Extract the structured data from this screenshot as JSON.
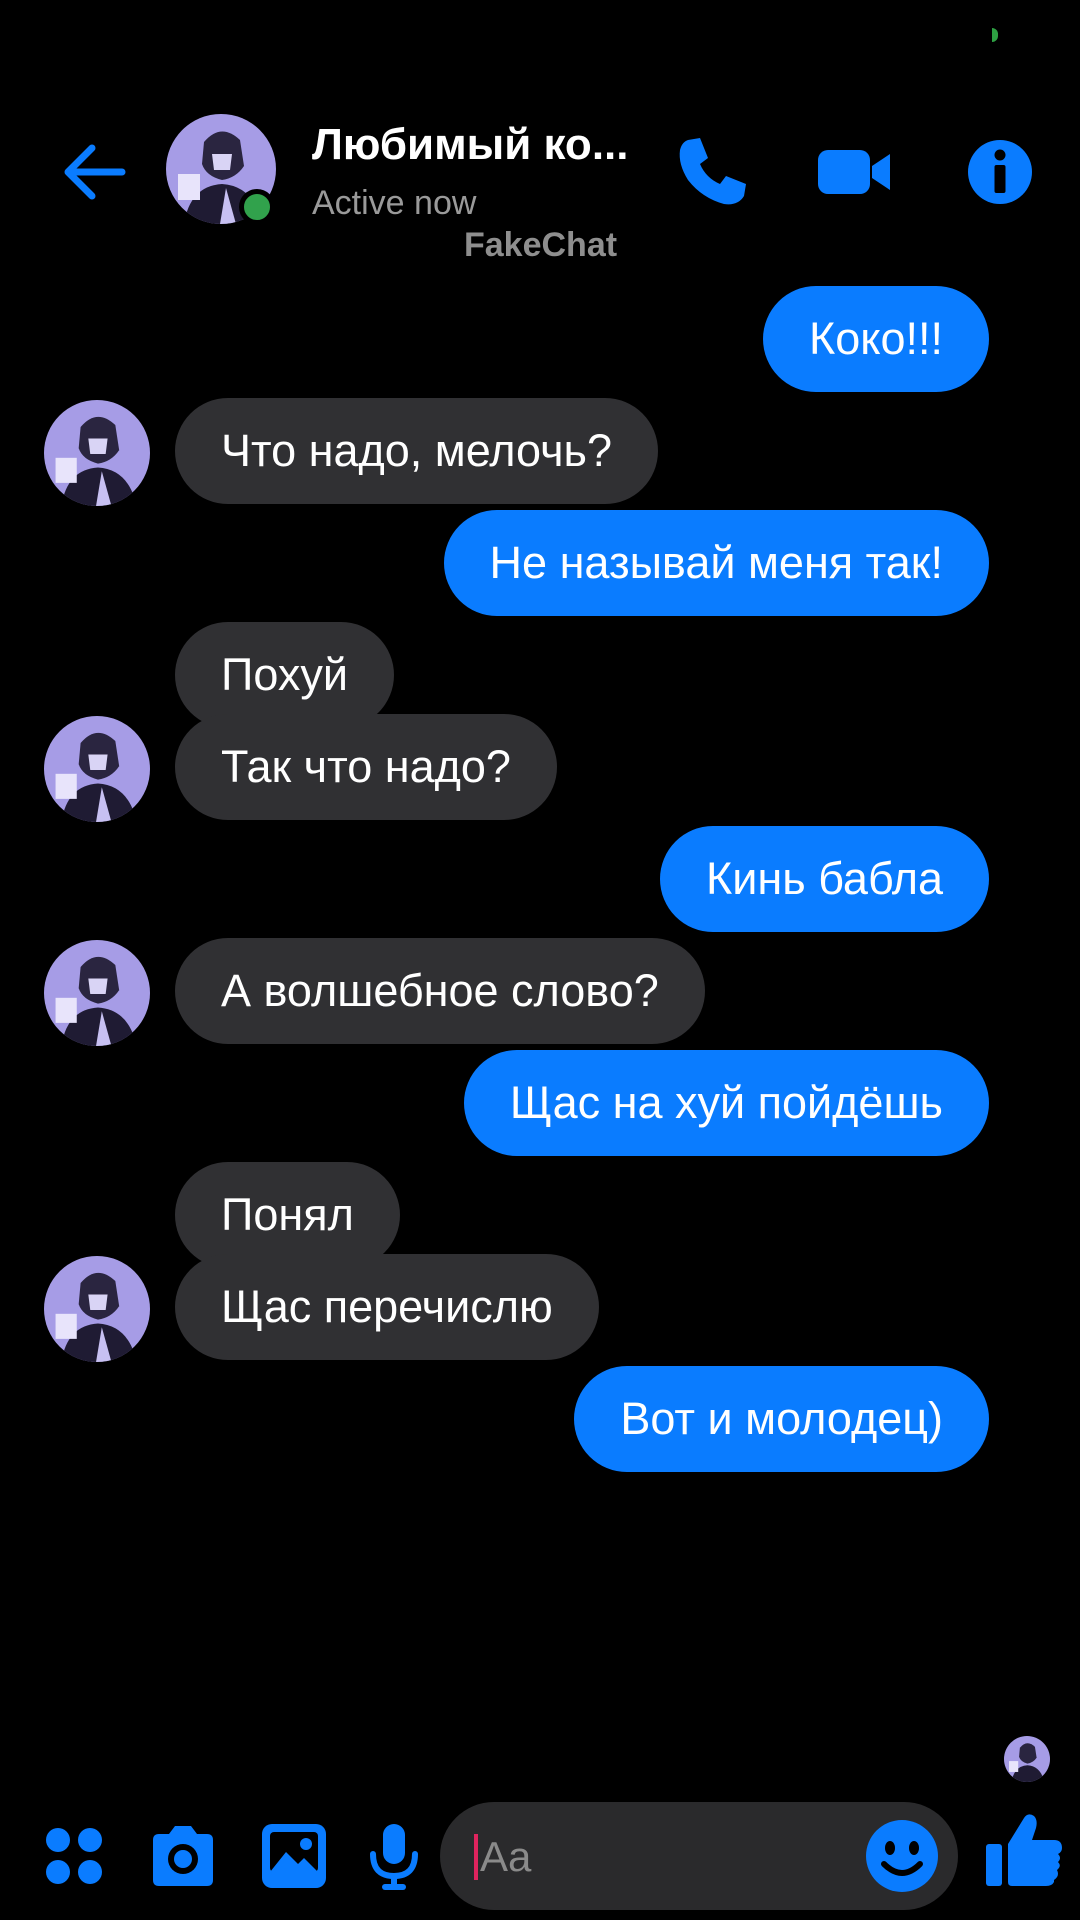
{
  "header": {
    "title": "Любимый ко...",
    "status": "Active now",
    "watermark": "FakeChat"
  },
  "messages": [
    {
      "direction": "out",
      "text": "Коко!!!"
    },
    {
      "direction": "in",
      "text": "Что надо, мелочь?",
      "show_avatar": true
    },
    {
      "direction": "out",
      "text": "Не называй меня так!"
    },
    {
      "direction": "in",
      "text": "Похуй",
      "show_avatar": false
    },
    {
      "direction": "in",
      "text": "Так что надо?",
      "show_avatar": true
    },
    {
      "direction": "out",
      "text": "Кинь бабла"
    },
    {
      "direction": "in",
      "text": "А волшебное слово?",
      "show_avatar": true
    },
    {
      "direction": "out",
      "text": "Щас на хуй пойдёшь"
    },
    {
      "direction": "in",
      "text": "Понял",
      "show_avatar": false
    },
    {
      "direction": "in",
      "text": "Щас перечислю",
      "show_avatar": true
    },
    {
      "direction": "out",
      "text": "Вот и молодец)"
    }
  ],
  "composer": {
    "placeholder": "Aa"
  },
  "colors": {
    "accent": "#0a7cff",
    "incoming_bubble": "#303033",
    "online": "#31a24c",
    "background": "#000000"
  },
  "icons": [
    "back-arrow-icon",
    "phone-icon",
    "video-camera-icon",
    "info-icon",
    "apps-grid-icon",
    "camera-icon",
    "image-icon",
    "microphone-icon",
    "emoji-icon",
    "thumbs-up-icon"
  ]
}
